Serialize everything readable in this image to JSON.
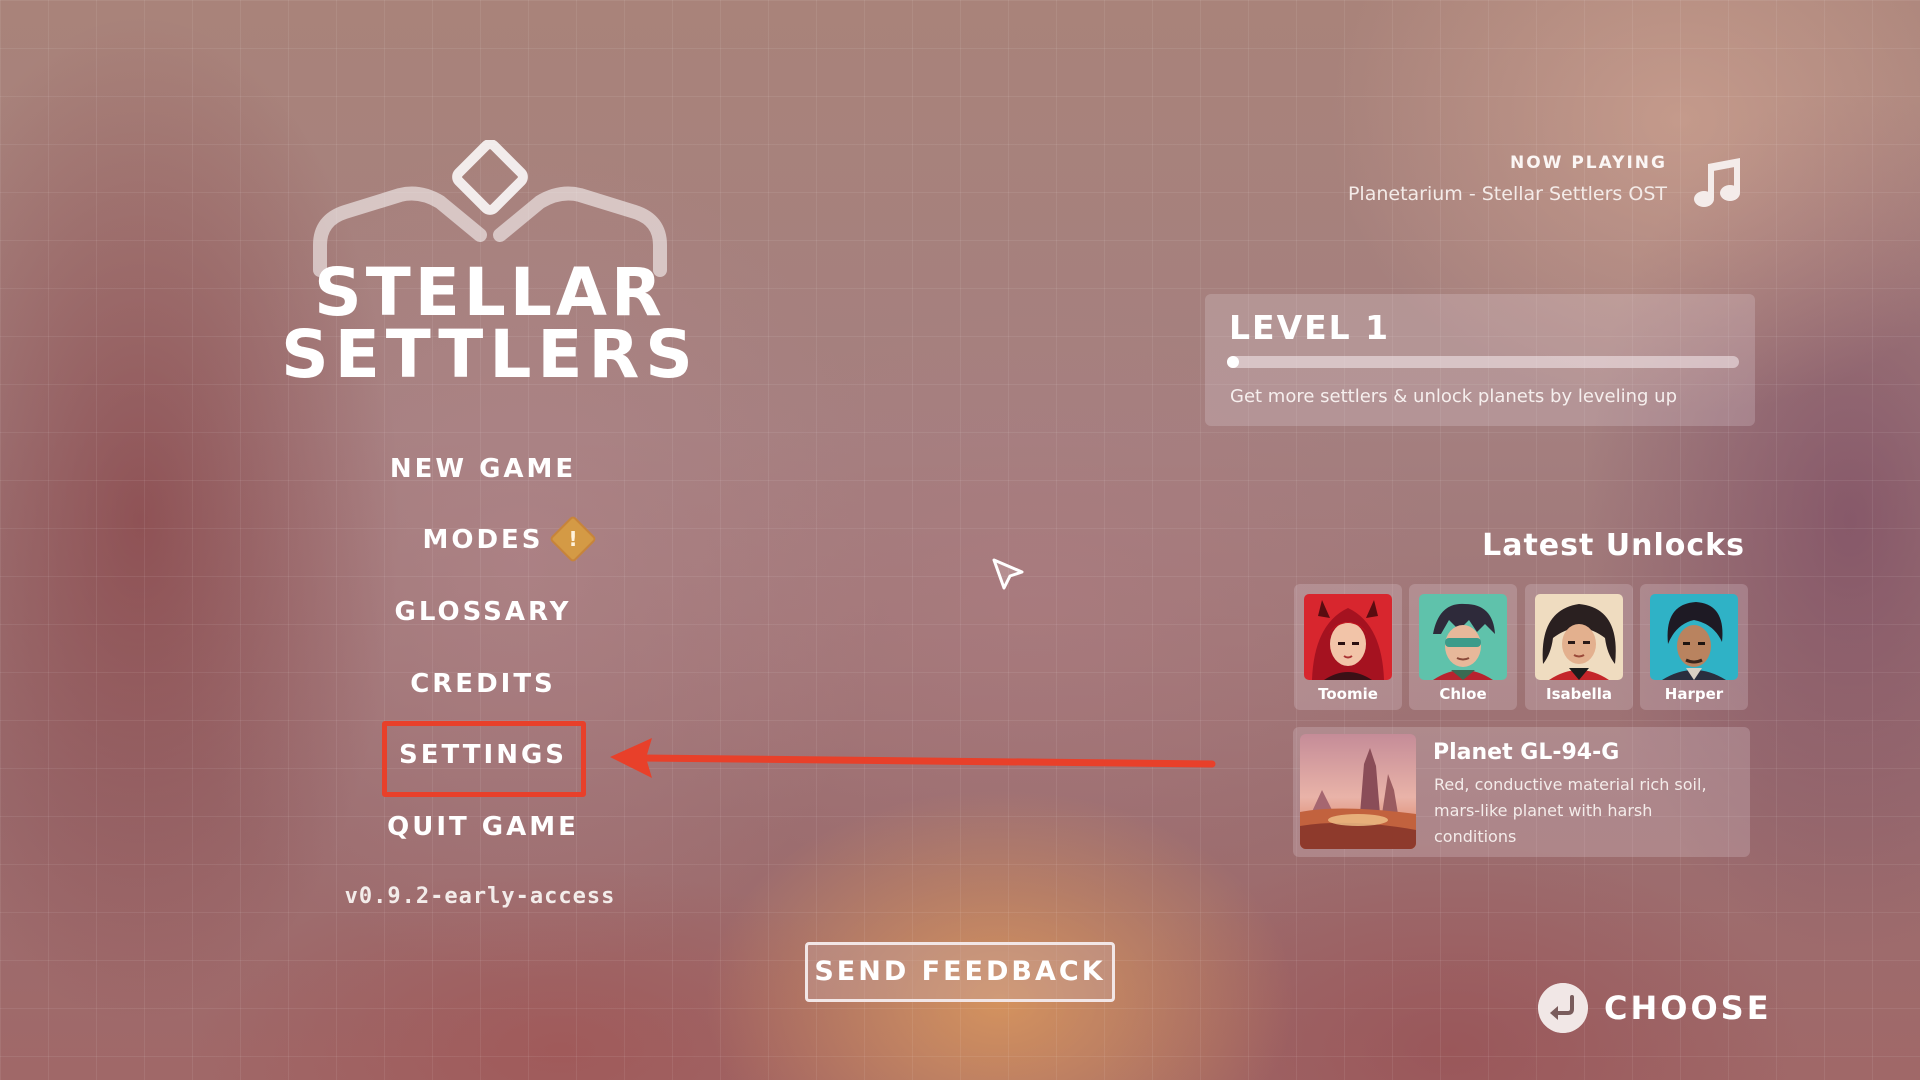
{
  "logo": {
    "line1": "STELLAR",
    "line2": "SETTLERS"
  },
  "menu": {
    "items": [
      {
        "label": "NEW GAME"
      },
      {
        "label": "MODES",
        "badge_icon": "warning-diamond-icon"
      },
      {
        "label": "GLOSSARY"
      },
      {
        "label": "CREDITS"
      },
      {
        "label": "SETTINGS",
        "highlighted": true
      },
      {
        "label": "QUIT GAME"
      }
    ],
    "version": "v0.9.2-early-access"
  },
  "now_playing": {
    "label": "NOW PLAYING",
    "track": "Planetarium - Stellar Settlers OST",
    "icon": "music-note-icon"
  },
  "level": {
    "title": "LEVEL 1",
    "progress": 0.0,
    "hint": "Get more settlers & unlock planets by leveling up"
  },
  "unlocks": {
    "title": "Latest Unlocks",
    "settlers": [
      {
        "name": "Toomie"
      },
      {
        "name": "Chloe"
      },
      {
        "name": "Isabella"
      },
      {
        "name": "Harper"
      }
    ],
    "planet": {
      "name": "Planet GL-94-G",
      "description": "Red, conductive material rich soil, mars-like planet with harsh conditions"
    }
  },
  "feedback_button": "SEND FEEDBACK",
  "choose_hint": {
    "label": "CHOOSE",
    "icon": "enter-return-icon"
  },
  "colors": {
    "highlight": "#e8402a",
    "warning": "#d49a45"
  }
}
